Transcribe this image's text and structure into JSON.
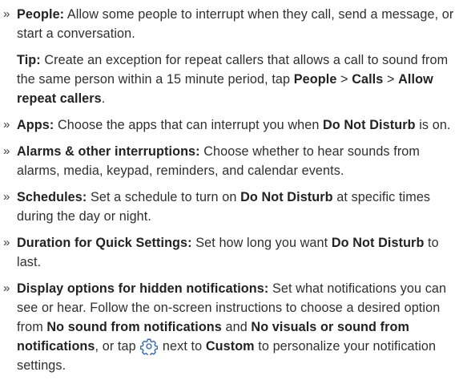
{
  "items": {
    "people": {
      "bullet": "»",
      "term": "People:",
      "text": " Allow some people to interrupt when they call, send a message, or start a conversation."
    },
    "tip": {
      "term": "Tip:",
      "text1": " Create an exception for repeat callers that allows a call to sound from the same person within a 15 minute period, tap ",
      "path1": "People",
      "sep1": " > ",
      "path2": "Calls",
      "sep2": " > ",
      "path3": "Allow repeat callers",
      "end": "."
    },
    "apps": {
      "bullet": "»",
      "term": "Apps:",
      "text1": " Choose the apps that can interrupt you when ",
      "bold1": "Do Not Disturb",
      "text2": " is on."
    },
    "alarms": {
      "bullet": "»",
      "term": "Alarms & other interruptions:",
      "text": " Choose whether to hear sounds from alarms, media, keypad, reminders, and calendar events."
    },
    "schedules": {
      "bullet": "»",
      "term": "Schedules:",
      "text1": " Set a schedule to turn on ",
      "bold1": "Do Not Disturb",
      "text2": " at specific times during the day or night."
    },
    "duration": {
      "bullet": "»",
      "term": "Duration for Quick Settings:",
      "text1": " Set how long you want ",
      "bold1": "Do Not Disturb",
      "text2": " to last."
    },
    "display": {
      "bullet": "»",
      "term": "Display options for hidden notifications:",
      "text1": " Set what notifications you can see or hear. Follow the on-screen instructions to choose a desired option from ",
      "bold1": "No sound from notifications",
      "text2": " and ",
      "bold2": "No visuals or sound from notifications",
      "text3": ", or tap ",
      "icon": "settings-gear-icon",
      "text4": " next to ",
      "bold3": "Custom",
      "text5": " to personalize your notification settings."
    }
  },
  "colors": {
    "text": "#2f2f2f",
    "icon": "#3b6fb6"
  }
}
